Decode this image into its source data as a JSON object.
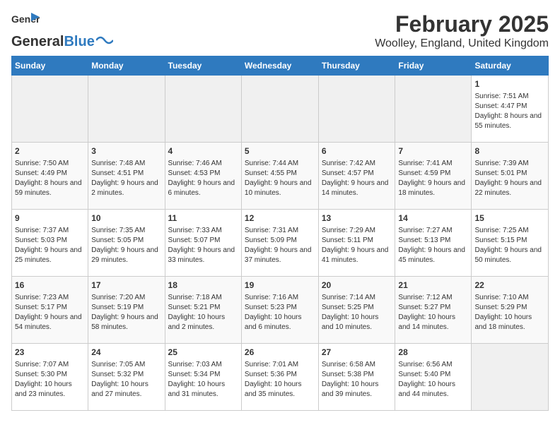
{
  "header": {
    "logo_line1": "General",
    "logo_line2": "Blue",
    "title": "February 2025",
    "subtitle": "Woolley, England, United Kingdom"
  },
  "weekdays": [
    "Sunday",
    "Monday",
    "Tuesday",
    "Wednesday",
    "Thursday",
    "Friday",
    "Saturday"
  ],
  "weeks": [
    [
      {
        "day": "",
        "info": ""
      },
      {
        "day": "",
        "info": ""
      },
      {
        "day": "",
        "info": ""
      },
      {
        "day": "",
        "info": ""
      },
      {
        "day": "",
        "info": ""
      },
      {
        "day": "",
        "info": ""
      },
      {
        "day": "1",
        "info": "Sunrise: 7:51 AM\nSunset: 4:47 PM\nDaylight: 8 hours and 55 minutes."
      }
    ],
    [
      {
        "day": "2",
        "info": "Sunrise: 7:50 AM\nSunset: 4:49 PM\nDaylight: 8 hours and 59 minutes."
      },
      {
        "day": "3",
        "info": "Sunrise: 7:48 AM\nSunset: 4:51 PM\nDaylight: 9 hours and 2 minutes."
      },
      {
        "day": "4",
        "info": "Sunrise: 7:46 AM\nSunset: 4:53 PM\nDaylight: 9 hours and 6 minutes."
      },
      {
        "day": "5",
        "info": "Sunrise: 7:44 AM\nSunset: 4:55 PM\nDaylight: 9 hours and 10 minutes."
      },
      {
        "day": "6",
        "info": "Sunrise: 7:42 AM\nSunset: 4:57 PM\nDaylight: 9 hours and 14 minutes."
      },
      {
        "day": "7",
        "info": "Sunrise: 7:41 AM\nSunset: 4:59 PM\nDaylight: 9 hours and 18 minutes."
      },
      {
        "day": "8",
        "info": "Sunrise: 7:39 AM\nSunset: 5:01 PM\nDaylight: 9 hours and 22 minutes."
      }
    ],
    [
      {
        "day": "9",
        "info": "Sunrise: 7:37 AM\nSunset: 5:03 PM\nDaylight: 9 hours and 25 minutes."
      },
      {
        "day": "10",
        "info": "Sunrise: 7:35 AM\nSunset: 5:05 PM\nDaylight: 9 hours and 29 minutes."
      },
      {
        "day": "11",
        "info": "Sunrise: 7:33 AM\nSunset: 5:07 PM\nDaylight: 9 hours and 33 minutes."
      },
      {
        "day": "12",
        "info": "Sunrise: 7:31 AM\nSunset: 5:09 PM\nDaylight: 9 hours and 37 minutes."
      },
      {
        "day": "13",
        "info": "Sunrise: 7:29 AM\nSunset: 5:11 PM\nDaylight: 9 hours and 41 minutes."
      },
      {
        "day": "14",
        "info": "Sunrise: 7:27 AM\nSunset: 5:13 PM\nDaylight: 9 hours and 45 minutes."
      },
      {
        "day": "15",
        "info": "Sunrise: 7:25 AM\nSunset: 5:15 PM\nDaylight: 9 hours and 50 minutes."
      }
    ],
    [
      {
        "day": "16",
        "info": "Sunrise: 7:23 AM\nSunset: 5:17 PM\nDaylight: 9 hours and 54 minutes."
      },
      {
        "day": "17",
        "info": "Sunrise: 7:20 AM\nSunset: 5:19 PM\nDaylight: 9 hours and 58 minutes."
      },
      {
        "day": "18",
        "info": "Sunrise: 7:18 AM\nSunset: 5:21 PM\nDaylight: 10 hours and 2 minutes."
      },
      {
        "day": "19",
        "info": "Sunrise: 7:16 AM\nSunset: 5:23 PM\nDaylight: 10 hours and 6 minutes."
      },
      {
        "day": "20",
        "info": "Sunrise: 7:14 AM\nSunset: 5:25 PM\nDaylight: 10 hours and 10 minutes."
      },
      {
        "day": "21",
        "info": "Sunrise: 7:12 AM\nSunset: 5:27 PM\nDaylight: 10 hours and 14 minutes."
      },
      {
        "day": "22",
        "info": "Sunrise: 7:10 AM\nSunset: 5:29 PM\nDaylight: 10 hours and 18 minutes."
      }
    ],
    [
      {
        "day": "23",
        "info": "Sunrise: 7:07 AM\nSunset: 5:30 PM\nDaylight: 10 hours and 23 minutes."
      },
      {
        "day": "24",
        "info": "Sunrise: 7:05 AM\nSunset: 5:32 PM\nDaylight: 10 hours and 27 minutes."
      },
      {
        "day": "25",
        "info": "Sunrise: 7:03 AM\nSunset: 5:34 PM\nDaylight: 10 hours and 31 minutes."
      },
      {
        "day": "26",
        "info": "Sunrise: 7:01 AM\nSunset: 5:36 PM\nDaylight: 10 hours and 35 minutes."
      },
      {
        "day": "27",
        "info": "Sunrise: 6:58 AM\nSunset: 5:38 PM\nDaylight: 10 hours and 39 minutes."
      },
      {
        "day": "28",
        "info": "Sunrise: 6:56 AM\nSunset: 5:40 PM\nDaylight: 10 hours and 44 minutes."
      },
      {
        "day": "",
        "info": ""
      }
    ]
  ]
}
